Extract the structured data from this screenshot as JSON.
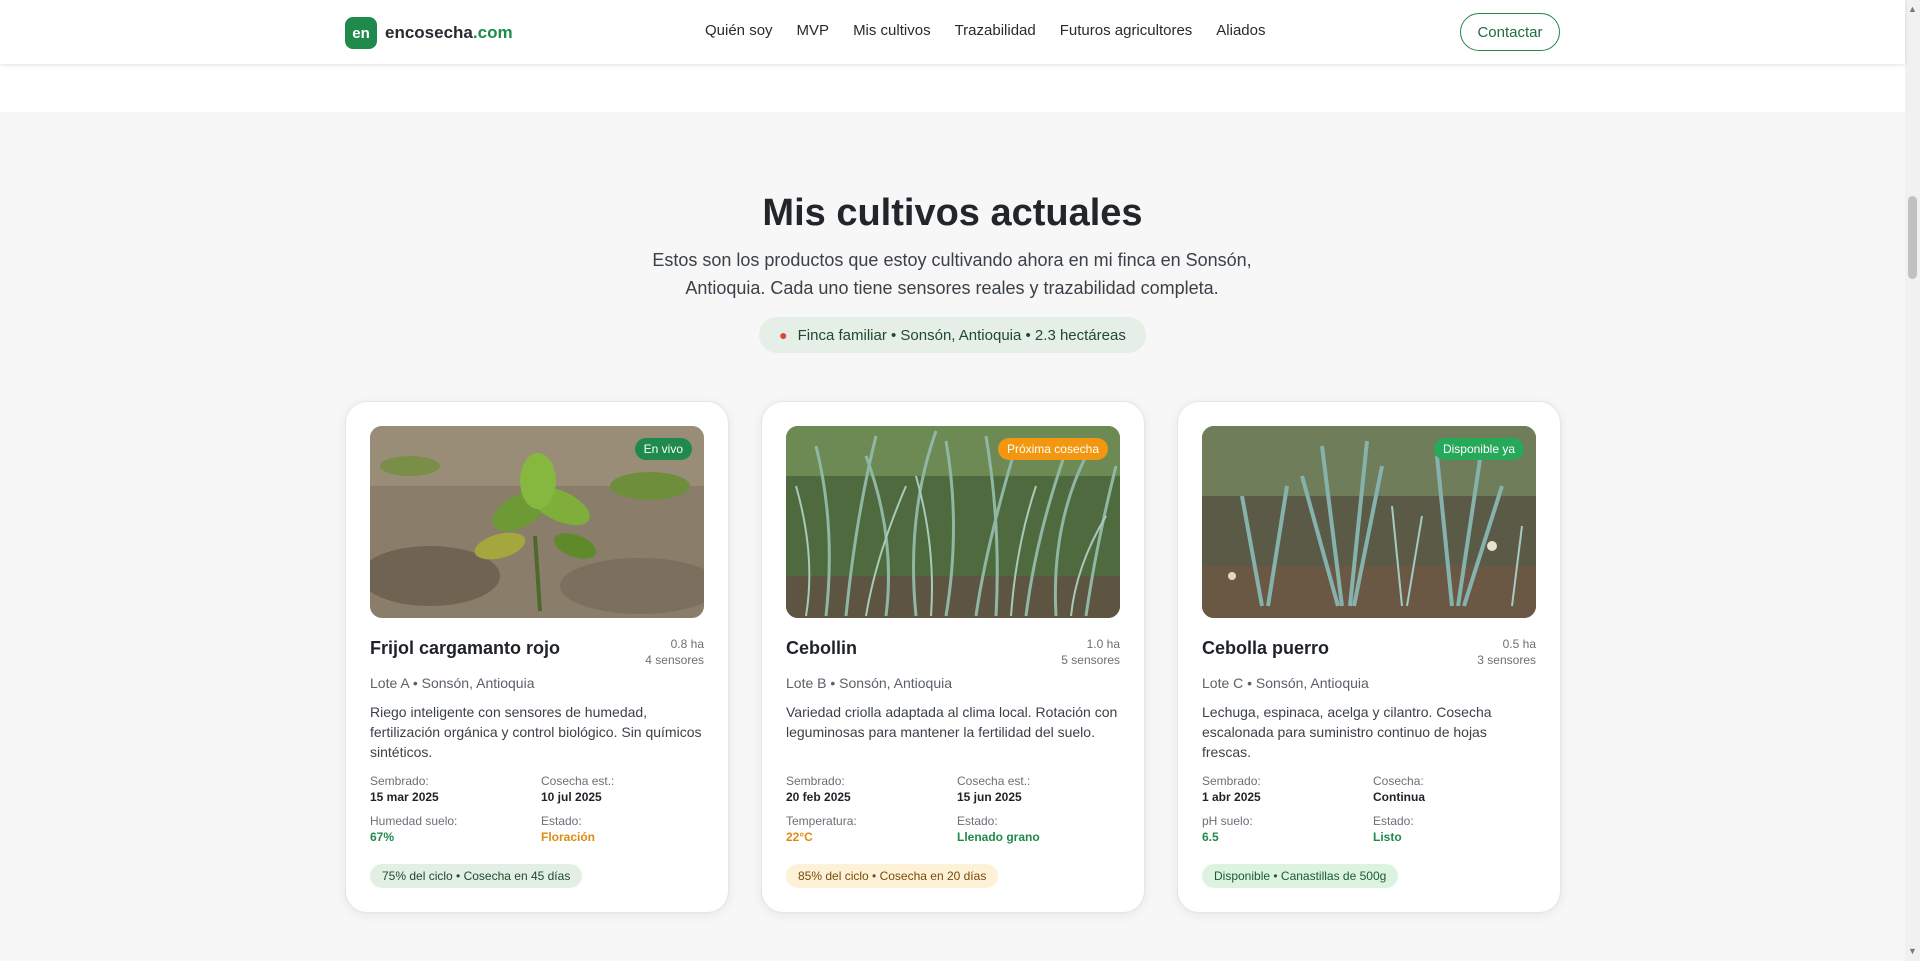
{
  "header": {
    "logo_badge": "en",
    "logo_name": "encosecha",
    "logo_tld": ".com",
    "nav": [
      "Quién soy",
      "MVP",
      "Mis cultivos",
      "Trazabilidad",
      "Futuros agricultores",
      "Aliados"
    ],
    "contact_label": "Contactar"
  },
  "section": {
    "title": "Mis cultivos actuales",
    "subtitle": "Estos son los productos que estoy cultivando ahora en mi finca en Sonsón, Antioquia. Cada uno tiene sensores reales y trazabilidad completa.",
    "location_icon": "map-pin-icon",
    "location": "Finca familiar • Sonsón, Antioquia • 2.3 hectáreas"
  },
  "cards": [
    {
      "badge": "En vivo",
      "badge_color": "#1f8a4c",
      "name": "Frijol cargamanto rojo",
      "area": "0.8 ha",
      "sensors": "4 sensores",
      "location": "Lote A • Sonsón, Antioquia",
      "description": "Riego inteligente con sensores de humedad, fertilización orgánica y control biológico. Sin químicos sintéticos.",
      "stats": [
        {
          "label": "Sembrado:",
          "value": "15 mar 2025",
          "color": "#1f2328"
        },
        {
          "label": "Cosecha est.:",
          "value": "10 jul 2025",
          "color": "#1f2328"
        },
        {
          "label": "Humedad suelo:",
          "value": "67%",
          "color": "#1f8a4c"
        },
        {
          "label": "Estado:",
          "value": "Floración",
          "color": "#e08a12"
        }
      ],
      "progress": "75% del ciclo • Cosecha en 45 días",
      "progress_bg": "#e3efe5",
      "progress_color": "#1f4a2c"
    },
    {
      "badge": "Próxima cosecha",
      "badge_color": "#f2970f",
      "name": "Cebollin",
      "area": "1.0 ha",
      "sensors": "5 sensores",
      "location": "Lote B • Sonsón, Antioquia",
      "description": "Variedad criolla adaptada al clima local. Rotación con leguminosas para mantener la fertilidad del suelo.",
      "stats": [
        {
          "label": "Sembrado:",
          "value": "20 feb 2025",
          "color": "#1f2328"
        },
        {
          "label": "Cosecha est.:",
          "value": "15 jun 2025",
          "color": "#1f2328"
        },
        {
          "label": "Temperatura:",
          "value": "22°C",
          "color": "#e08a12"
        },
        {
          "label": "Estado:",
          "value": "Llenado grano",
          "color": "#1f8a4c"
        }
      ],
      "progress": "85% del ciclo • Cosecha en 20 días",
      "progress_bg": "#fdf1d8",
      "progress_color": "#7a4a07"
    },
    {
      "badge": "Disponible ya",
      "badge_color": "#27a95a",
      "name": "Cebolla puerro",
      "area": "0.5 ha",
      "sensors": "3 sensores",
      "location": "Lote C • Sonsón, Antioquia",
      "description": "Lechuga, espinaca, acelga y cilantro. Cosecha escalonada para suministro continuo de hojas frescas.",
      "stats": [
        {
          "label": "Sembrado:",
          "value": "1 abr 2025",
          "color": "#1f2328"
        },
        {
          "label": "Cosecha:",
          "value": "Continua",
          "color": "#1f2328"
        },
        {
          "label": "pH suelo:",
          "value": "6.5",
          "color": "#1f8a4c"
        },
        {
          "label": "Estado:",
          "value": "Listo",
          "color": "#1f8a4c"
        }
      ],
      "progress": "Disponible • Canastillas de 500g",
      "progress_bg": "#dcf3e2",
      "progress_color": "#1b5a32"
    }
  ]
}
